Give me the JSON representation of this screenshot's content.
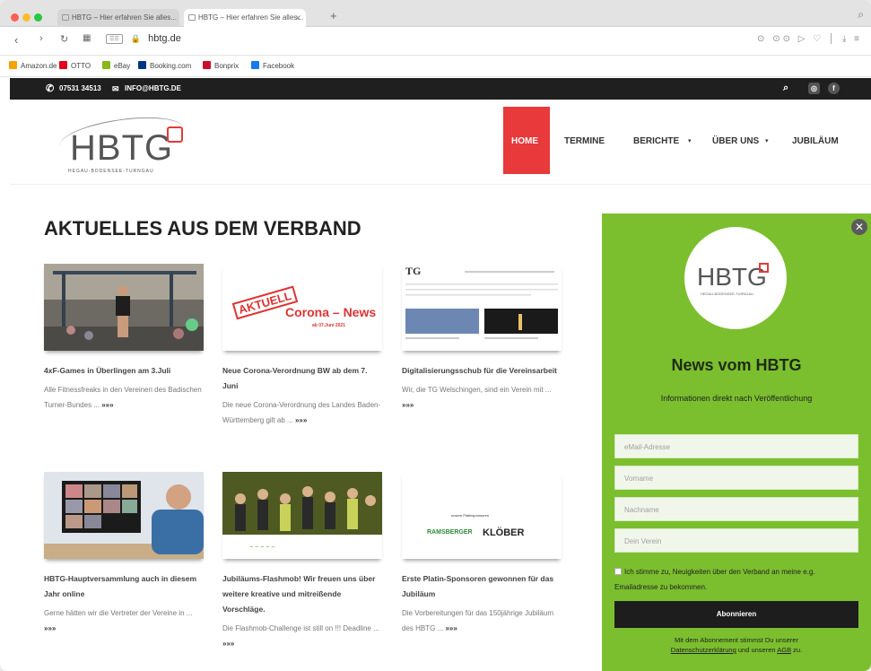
{
  "browser": {
    "tabs": [
      {
        "label": "HBTG – Hier erfahren Sie alles..."
      },
      {
        "label": "HBTG – Hier erfahren Sie alles..."
      }
    ],
    "url": "hbtg.de",
    "bookmarks": [
      {
        "label": "Amazon.de",
        "color": "#f7a200"
      },
      {
        "label": "OTTO",
        "color": "#e2001a"
      },
      {
        "label": "eBay",
        "color": "#86b817"
      },
      {
        "label": "Booking.com",
        "color": "#003580"
      },
      {
        "label": "Bonprix",
        "color": "#c8102e"
      },
      {
        "label": "Facebook",
        "color": "#1877f2"
      }
    ]
  },
  "topbar": {
    "phone": "07531 34513",
    "email": "INFO@HBTG.DE"
  },
  "logo": {
    "text": "HBTG",
    "tagline": "HEGAU-BODENSEE-TURNGAU"
  },
  "nav": {
    "items": [
      {
        "label": "HOME"
      },
      {
        "label": "TERMINE"
      },
      {
        "label": "BERICHTE"
      },
      {
        "label": "ÜBER UNS"
      },
      {
        "label": "JUBILÄUM"
      }
    ]
  },
  "main": {
    "heading": "AKTUELLES AUS DEM VERBAND",
    "more_label": "»»»",
    "posts": [
      {
        "title": "4xF-Games in Überlingen am 3.Juli",
        "excerpt": "Alle Fitnessfreaks in den Vereinen des Badischen Turner-Bundes ..."
      },
      {
        "title": "Neue Corona-Verordnung BW ab dem 7. Juni",
        "excerpt": "Die neue Corona-Verordnung des Landes Baden-Württemberg gilt ab ..."
      },
      {
        "title": "Digitalisierungsschub für die Vereinsarbeit",
        "excerpt": "Wir, die TG Welschingen, sind ein Verein mit ..."
      },
      {
        "title": "HBTG-Hauptversammlung auch in diesem Jahr online",
        "excerpt": "Gerne hätten wir die Vertreter der Vereine in ..."
      },
      {
        "title": "Jubiläums-Flashmob! Wir freuen uns über weitere kreative und mitreißende Vorschläge.",
        "excerpt": "Die Flashmob-Challenge ist still on !!! Deadline ..."
      },
      {
        "title": "Erste Platin-Sponsoren gewonnen für das Jubiläum",
        "excerpt": "Die Vorbereitungen für das 150jährige Jubiläum des HBTG ..."
      }
    ],
    "thumb_texts": {
      "aktuell": "AKTUELL",
      "corona": "Corona – News",
      "corona_date": "ab 07.Juni 2021",
      "sponsor_kloeber": "KLÖBER",
      "sponsor_rb": "RAMSBERGER",
      "sponsors_caption": "unsere Platinsponsoren"
    }
  },
  "popup": {
    "title": "News vom HBTG",
    "subtitle": "Informationen direkt nach Veröffentlichung",
    "fields": [
      {
        "placeholder": "eMail-Adresse"
      },
      {
        "placeholder": "Vorname"
      },
      {
        "placeholder": "Nachname"
      },
      {
        "placeholder": "Dein Verein"
      }
    ],
    "consent": "Ich stimme zu, Neuigkeiten über den Verband an meine e.g. Emailadresse zu bekommen.",
    "button": "Abonnieren",
    "note_prefix": "Mit dem Abonnement stimmst Du unserer",
    "note_link1": "Datenschutzerklärung",
    "note_mid": "und unseren",
    "note_link2": "AGB",
    "note_suffix": "zu."
  }
}
